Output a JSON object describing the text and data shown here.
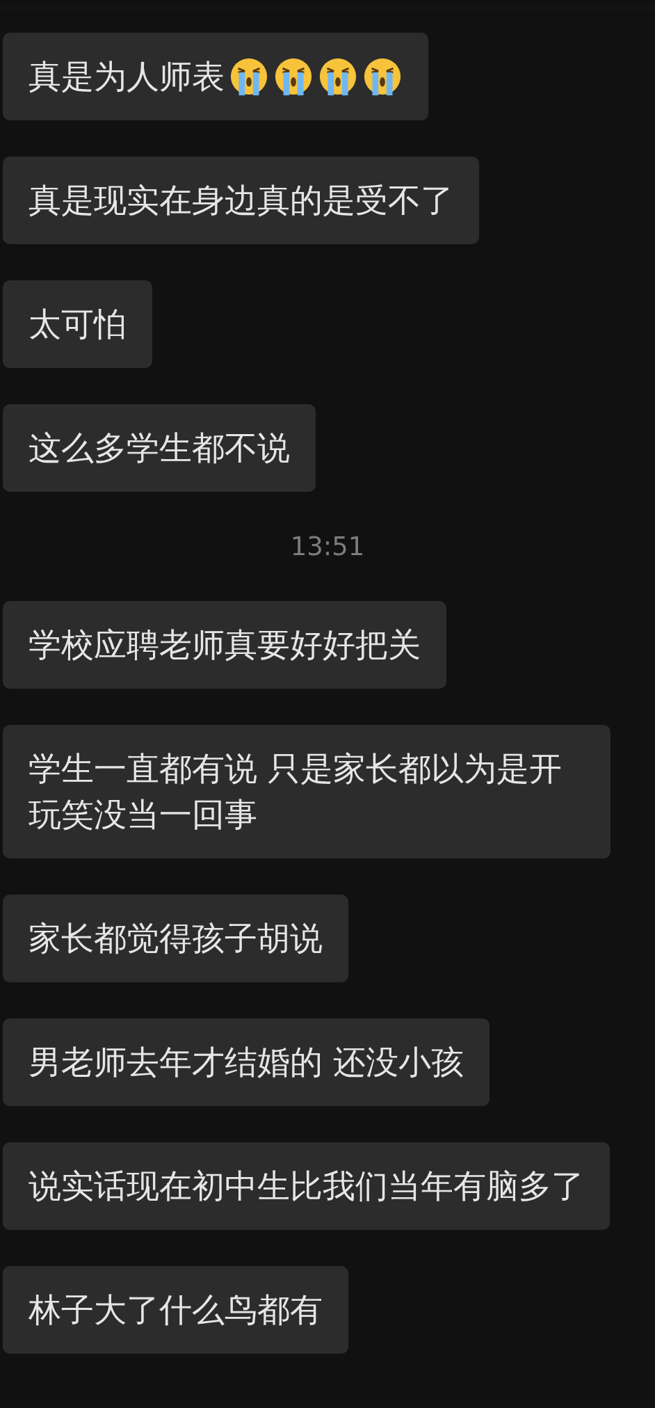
{
  "items": [
    {
      "kind": "message",
      "parts": [
        {
          "kind": "text",
          "text": "真是为人师表"
        },
        {
          "kind": "emoji"
        },
        {
          "kind": "emoji"
        },
        {
          "kind": "emoji"
        },
        {
          "kind": "emoji"
        }
      ]
    },
    {
      "kind": "message",
      "parts": [
        {
          "kind": "text",
          "text": "真是现实在身边真的是受不了"
        }
      ]
    },
    {
      "kind": "message",
      "parts": [
        {
          "kind": "text",
          "text": "太可怕"
        }
      ]
    },
    {
      "kind": "message",
      "parts": [
        {
          "kind": "text",
          "text": "这么多学生都不说"
        }
      ]
    },
    {
      "kind": "time",
      "text": "13:51"
    },
    {
      "kind": "message",
      "parts": [
        {
          "kind": "text",
          "text": "学校应聘老师真要好好把关"
        }
      ]
    },
    {
      "kind": "message",
      "parts": [
        {
          "kind": "text",
          "text": "学生一直都有说 只是家长都以为是开玩笑没当一回事"
        }
      ]
    },
    {
      "kind": "message",
      "parts": [
        {
          "kind": "text",
          "text": "家长都觉得孩子胡说"
        }
      ]
    },
    {
      "kind": "message",
      "parts": [
        {
          "kind": "text",
          "text": "男老师去年才结婚的 还没小孩"
        }
      ]
    },
    {
      "kind": "message",
      "parts": [
        {
          "kind": "text",
          "text": "说实话现在初中生比我们当年有脑多了"
        }
      ]
    },
    {
      "kind": "message",
      "parts": [
        {
          "kind": "text",
          "text": "林子大了什么鸟都有"
        }
      ]
    }
  ]
}
